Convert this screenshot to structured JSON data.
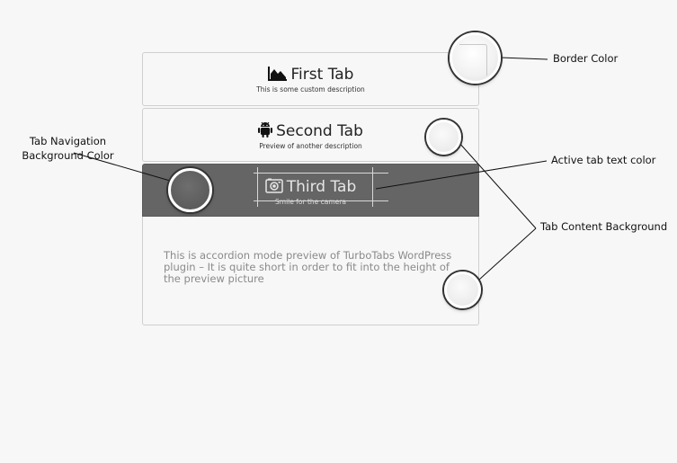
{
  "tabs": [
    {
      "title": "First Tab",
      "description": "This is some custom description",
      "icon": "area-chart-icon"
    },
    {
      "title": "Second Tab",
      "description": "Preview of another description",
      "icon": "android-icon"
    },
    {
      "title": "Third Tab",
      "description": "Smile for the camera",
      "icon": "camera-icon"
    }
  ],
  "active_tab": 2,
  "content": {
    "text": "This is accordion mode preview of TurboTabs WordPress plugin – It is quite short in order to fit into the height of the preview picture"
  },
  "annotations": {
    "border_color": "Border Color",
    "tab_nav_bg": "Tab Navigation Background Color",
    "active_text_color": "Active tab text color",
    "content_bg": "Tab Content Background"
  },
  "colors": {
    "page_bg": "#f7f7f7",
    "tab_border": "#cfcfcf",
    "active_tab_bg": "#656565",
    "active_tab_text": "#e6e6e6",
    "content_text": "#8a8a8a"
  }
}
